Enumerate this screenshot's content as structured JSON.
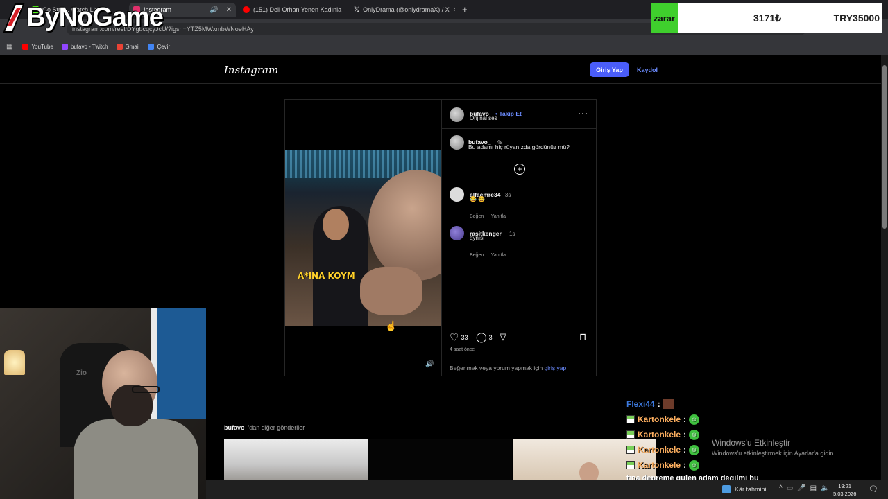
{
  "browser": {
    "tabs": [
      {
        "label": "Go Stre... Watch Live...",
        "color": "#53fc18",
        "active": false
      },
      {
        "label": "Instagram",
        "color": "#e1306c",
        "active": true
      },
      {
        "label": "(151) Deli Orhan Yenen Kadınla",
        "color": "#ff0000",
        "active": false
      },
      {
        "label": "OnlyDrama (@onlydramaX) / X",
        "color": "#000000",
        "active": false
      }
    ],
    "new_tab_icon": "plus-icon",
    "url": "instagram.com/reel/DYgbcqcyJcU/?igsh=YTZ5MWxmbWNoeHAy",
    "bookmarks": [
      {
        "label": "YouTube",
        "color": "#ff0000"
      },
      {
        "label": "bufavo - Twitch",
        "color": "#9146ff"
      },
      {
        "label": "Gmail",
        "color": "#ea4335"
      },
      {
        "label": "Çevir",
        "color": "#4285f4"
      }
    ]
  },
  "overlay": {
    "logo_text": "ByNoGame",
    "ticker": {
      "left": "zarar",
      "mid": "3171₺",
      "right": "TRY35000"
    }
  },
  "instagram": {
    "logo": "Instagram",
    "login_label": "Giriş Yap",
    "signup_label": "Kaydol",
    "post": {
      "author": "bufavo_",
      "follow_label": "Takip Et",
      "audio": "Orijinal ses",
      "caption_user": "bufavo_",
      "caption_time": "4s",
      "caption_text": "Bu adamı hiç rüyanızda gördünüz mü?",
      "video_caption": "A*INA KOYM",
      "comments": [
        {
          "user": "alfaemre34",
          "time": "3s",
          "text": "😂 😂",
          "like": "Beğen",
          "reply": "Yanıtla"
        },
        {
          "user": "rasitkenger_",
          "time": "1s",
          "text": "aynısı",
          "like": "Beğen",
          "reply": "Yanıtla"
        }
      ],
      "likes": "33",
      "comment_count": "3",
      "age": "4 saat önce",
      "login_prompt": "Beğenmek veya yorum yapmak için",
      "login_link": "giriş yap",
      "login_end": "."
    },
    "more_posts_user": "bufavo_",
    "more_posts_suffix": "'dan diğer gönderiler"
  },
  "webcam": {
    "chair_text": "Zio"
  },
  "chat": {
    "messages": [
      {
        "user": "Flexi44",
        "sep": ":",
        "color": "#3d7adf"
      },
      {
        "user": "Kartonkele",
        "sep": ":",
        "color": "#ffb060"
      },
      {
        "user": "Kartonkele",
        "sep": ":",
        "color": "#ffb060"
      },
      {
        "user": "Kartonkele",
        "sep": ":",
        "color": "#ffb060"
      },
      {
        "user": "Kartonkele",
        "sep": ":",
        "color": "#ffb060"
      }
    ],
    "last_text": "tına depreme gulen adam degilmi bu"
  },
  "windows": {
    "activate_title": "Windows'u Etkinleştir",
    "activate_sub": "Windows'u etkinleştirmek için Ayarlar'a gidin.",
    "weather": "Kâr tahmini",
    "time": "19:21",
    "date": "5.03.2026"
  }
}
